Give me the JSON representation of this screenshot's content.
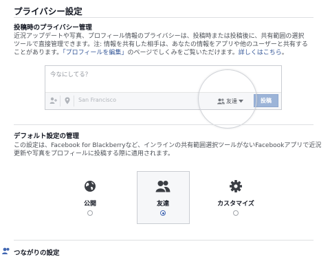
{
  "page": {
    "title": "プライバシー設定"
  },
  "post_privacy": {
    "heading": "投稿時のプライバシー管理",
    "line1": "近況アップデートや写真、プロフィール情報のプライバシーは、投稿時または投稿後に、共有範囲の選択",
    "line2": "ツールで直接管理できます。注: 情報を共有した相手は、あなたの情報をアプリや他のユーザーと共有する",
    "line3_prefix": "ことがあります。",
    "edit_profile_link": "「プロフィールを編集」",
    "line3_middle": "のページでしくみをご覧いただけます。",
    "learn_more_link": "詳しくはこちら",
    "line3_suffix": "。"
  },
  "composer": {
    "placeholder": "今なにしてる？",
    "location": "San Francisco",
    "audience_label": "友達",
    "post_label": "投稿"
  },
  "default_privacy": {
    "heading": "デフォルト設定の管理",
    "line1": "この設定は、Facebook for Blackberryなど、インラインの共有範囲選択ツールがないFacebookアプリで近況",
    "line2": "更新や写真をプロフィールに投稿する際に適用されます。",
    "options": [
      {
        "label": "公開",
        "icon": "globe-icon",
        "selected": false
      },
      {
        "label": "友達",
        "icon": "friends-icon",
        "selected": true
      },
      {
        "label": "カスタマイズ",
        "icon": "gear-icon",
        "selected": false
      }
    ]
  },
  "next_section": {
    "heading": "つながりの設定"
  },
  "colors": {
    "link": "#365899",
    "post_button": "#9cb4d8",
    "radio_selected": "#4267b2"
  }
}
